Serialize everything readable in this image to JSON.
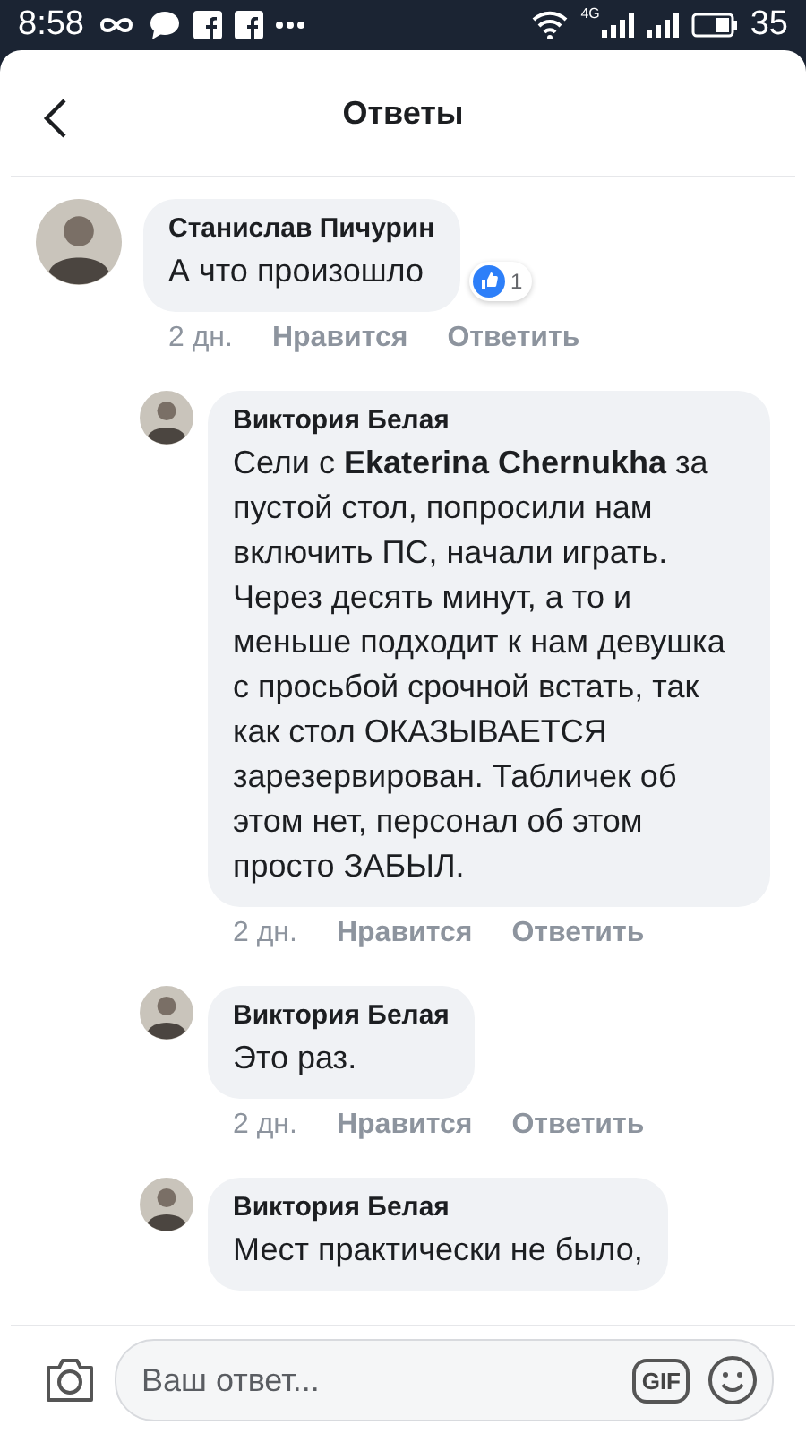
{
  "status_bar": {
    "time": "8:58",
    "network": "4G",
    "battery": "35"
  },
  "header": {
    "title": "Ответы"
  },
  "comments": [
    {
      "kind": "top",
      "author": "Станислав Пичурин",
      "text": "А что произошло",
      "reactions": "1",
      "time": "2 дн.",
      "like": "Нравится",
      "reply": "Ответить"
    },
    {
      "kind": "reply",
      "author": "Виктория Белая",
      "text": "Сели с **Ekaterina Chernukha** за пустой стол, попросили нам включить ПС, начали играть. Через десять минут, а то и меньше подходит к нам девушка с просьбой срочной встать, так как стол ОКАЗЫВАЕТСЯ зарезервирован. Табличек об этом нет, персонал об этом просто ЗАБЫЛ.",
      "time": "2 дн.",
      "like": "Нравится",
      "reply": "Ответить"
    },
    {
      "kind": "reply",
      "author": "Виктория Белая",
      "text": "Это раз.",
      "time": "2 дн.",
      "like": "Нравится",
      "reply": "Ответить"
    },
    {
      "kind": "reply",
      "author": "Виктория Белая",
      "text": "Мест практически не было,"
    }
  ],
  "composer": {
    "placeholder": "Ваш ответ...",
    "gif": "GIF"
  }
}
